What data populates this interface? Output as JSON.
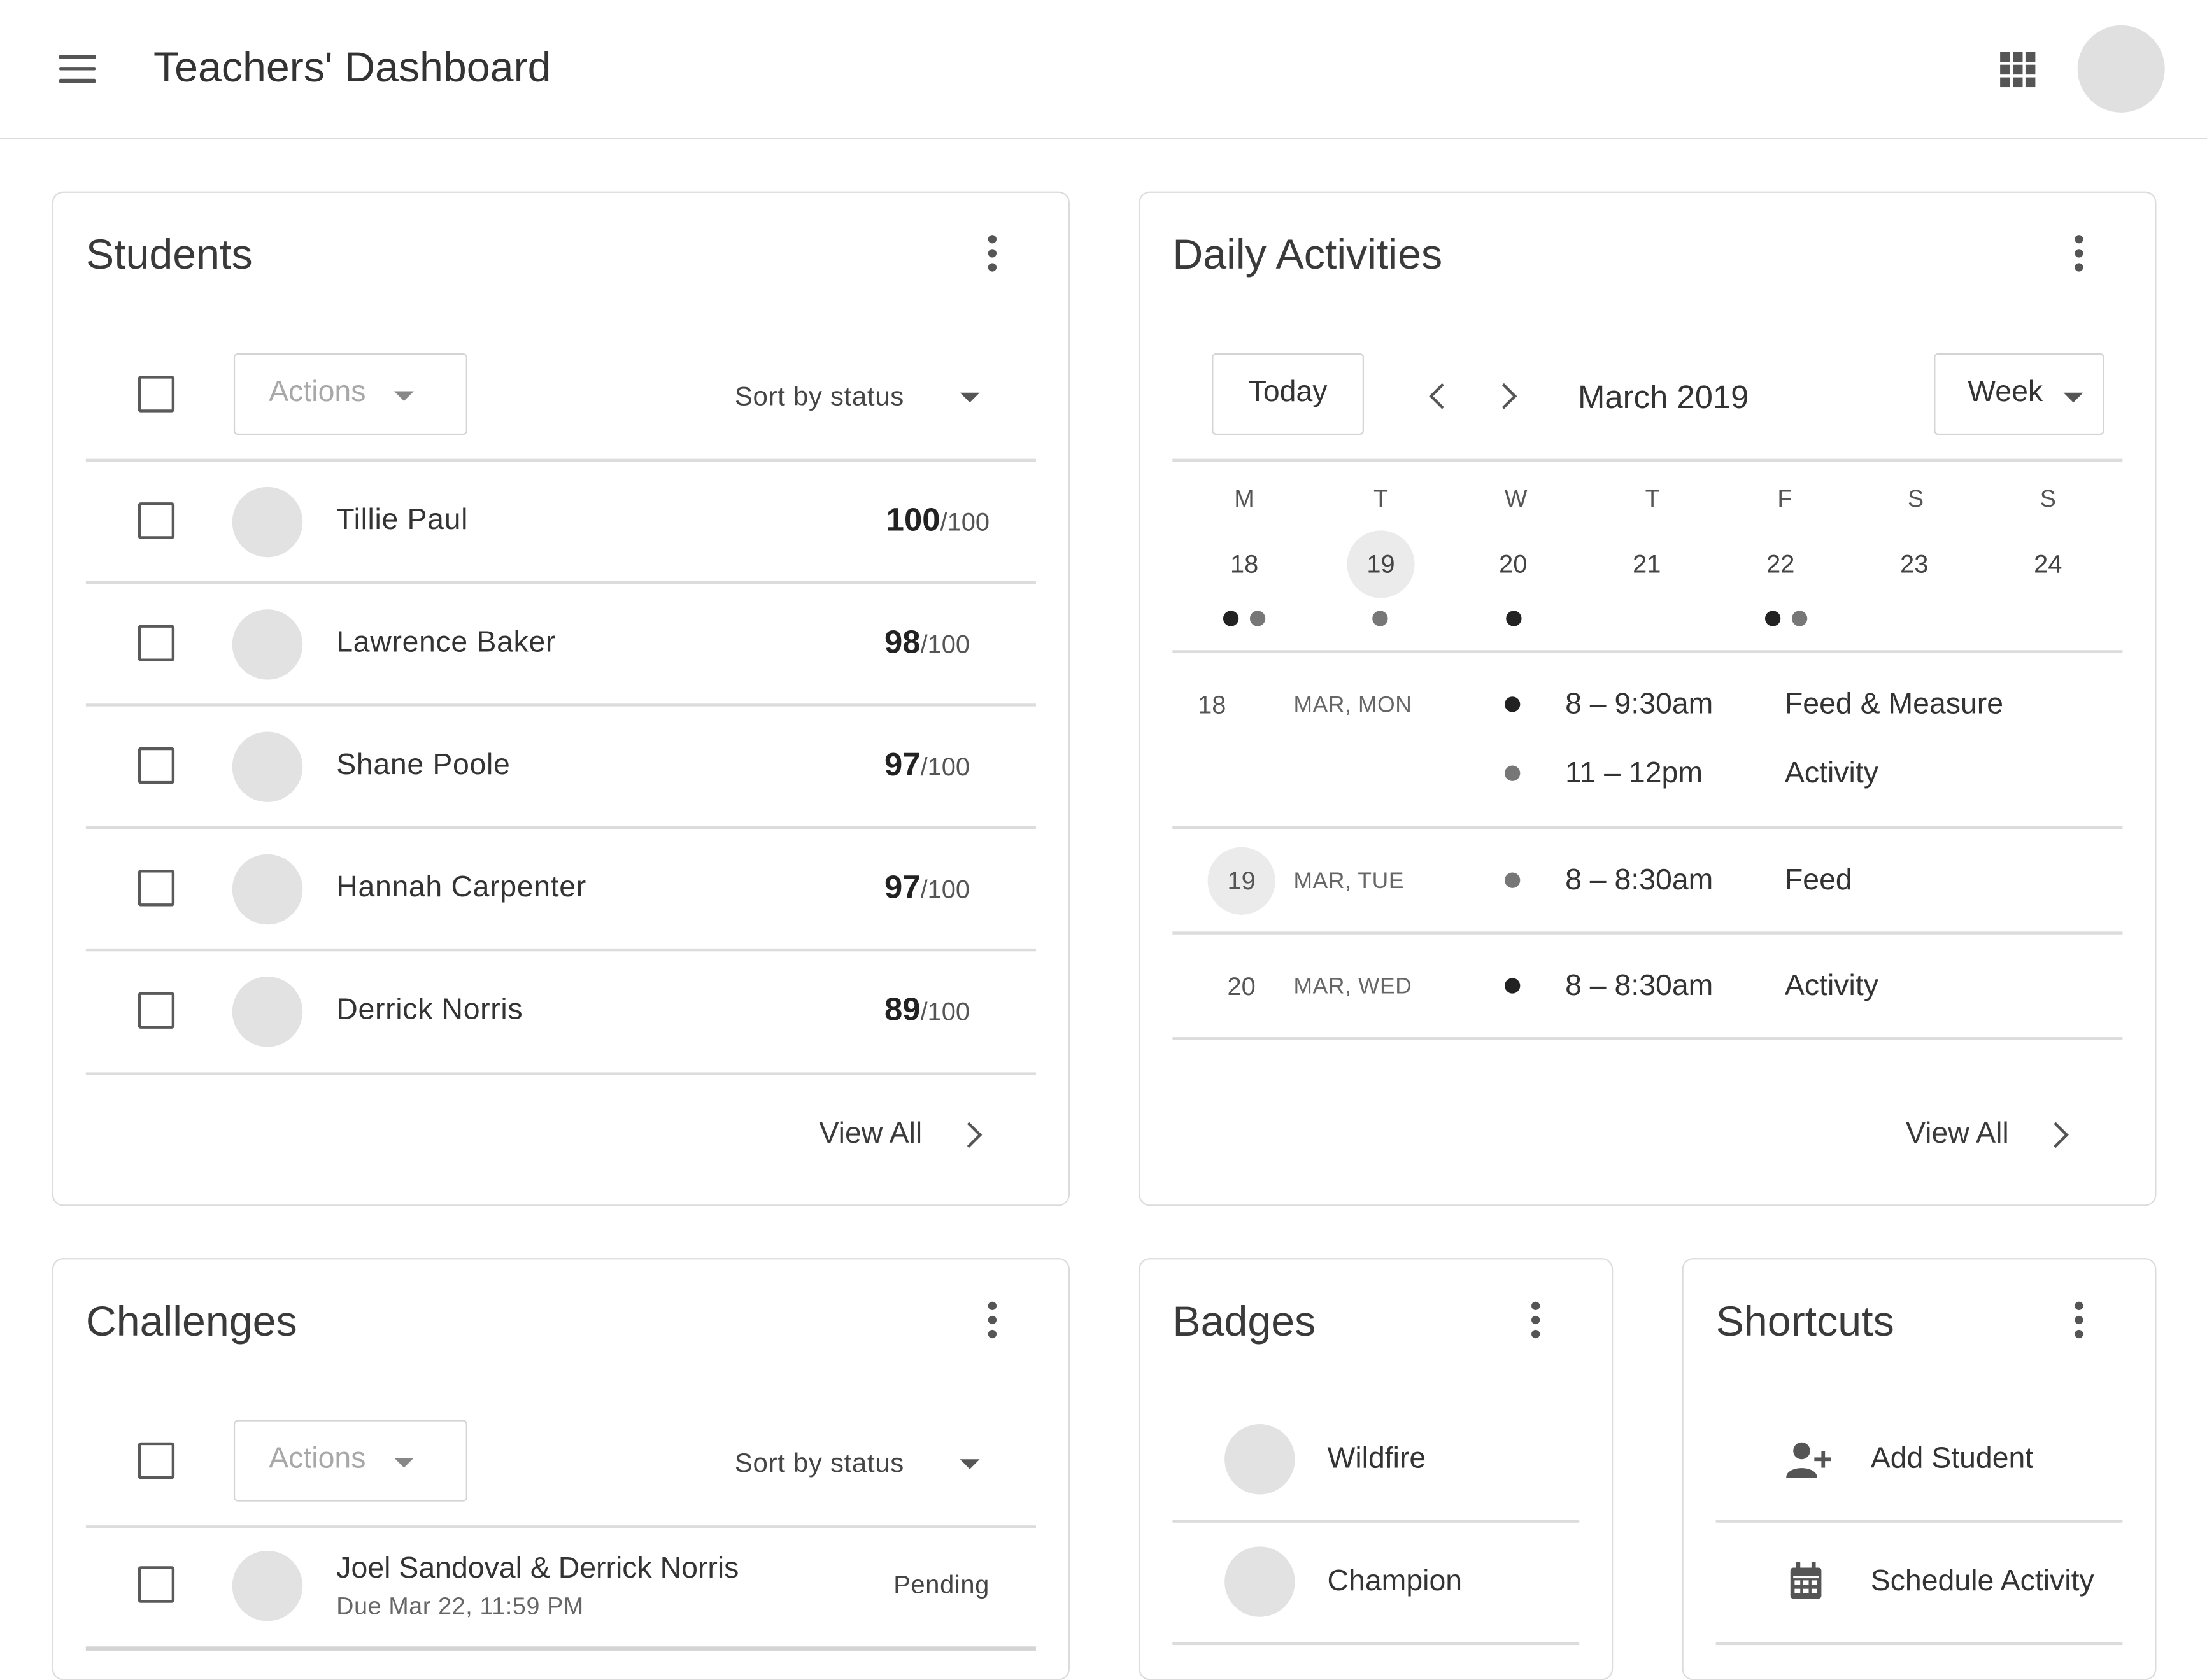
{
  "app": {
    "title": "Teachers' Dashboard"
  },
  "icons": {
    "menu": "menu-icon",
    "apps": "apps-grid-icon",
    "more": "more-vert-icon",
    "dropdown": "arrow-drop-down-icon",
    "chevron_left": "chevron-left-icon",
    "chevron_right": "chevron-right-icon",
    "add_person": "person-add-icon",
    "calendar": "calendar-icon"
  },
  "colors": {
    "dot_primary": "#222222",
    "dot_secondary": "#777777",
    "highlight": "#ebebeb"
  },
  "students": {
    "title": "Students",
    "actions_label": "Actions",
    "sort_label": "Sort by status",
    "rows": [
      {
        "name": "Tillie Paul",
        "score": "100",
        "max": "/100"
      },
      {
        "name": "Lawrence Baker",
        "score": "98",
        "max": "/100"
      },
      {
        "name": "Shane Poole",
        "score": "97",
        "max": "/100"
      },
      {
        "name": "Hannah Carpenter",
        "score": "97",
        "max": "/100"
      },
      {
        "name": "Derrick Norris",
        "score": "89",
        "max": "/100"
      }
    ],
    "view_all": "View All"
  },
  "daily": {
    "title": "Daily Activities",
    "today_label": "Today",
    "month": "March 2019",
    "view_label": "Week",
    "weekdays": [
      "M",
      "T",
      "W",
      "T",
      "F",
      "S",
      "S"
    ],
    "dates": [
      "18",
      "19",
      "20",
      "21",
      "22",
      "23",
      "24"
    ],
    "selected_date": "19",
    "events": [
      {
        "day": "18",
        "date": "MAR, MON",
        "items": [
          {
            "time": "8 – 9:30am",
            "title": "Feed & Measure",
            "dot": "dark"
          },
          {
            "time": "11 – 12pm",
            "title": "Activity",
            "dot": "gray"
          }
        ]
      },
      {
        "day": "19",
        "date": "MAR, TUE",
        "items": [
          {
            "time": "8 – 8:30am",
            "title": "Feed",
            "dot": "gray"
          }
        ]
      },
      {
        "day": "20",
        "date": "MAR, WED",
        "items": [
          {
            "time": "8 – 8:30am",
            "title": "Activity",
            "dot": "dark"
          }
        ]
      }
    ],
    "view_all": "View All"
  },
  "challenges": {
    "title": "Challenges",
    "actions_label": "Actions",
    "sort_label": "Sort by status",
    "rows": [
      {
        "name": "Joel Sandoval & Derrick Norris",
        "due": "Due Mar 22, 11:59 PM",
        "status": "Pending"
      }
    ]
  },
  "badges": {
    "title": "Badges",
    "items": [
      {
        "name": "Wildfire"
      },
      {
        "name": "Champion"
      }
    ]
  },
  "shortcuts": {
    "title": "Shortcuts",
    "items": [
      {
        "label": "Add Student",
        "icon": "person-add-icon"
      },
      {
        "label": "Schedule Activity",
        "icon": "calendar-icon"
      }
    ]
  }
}
